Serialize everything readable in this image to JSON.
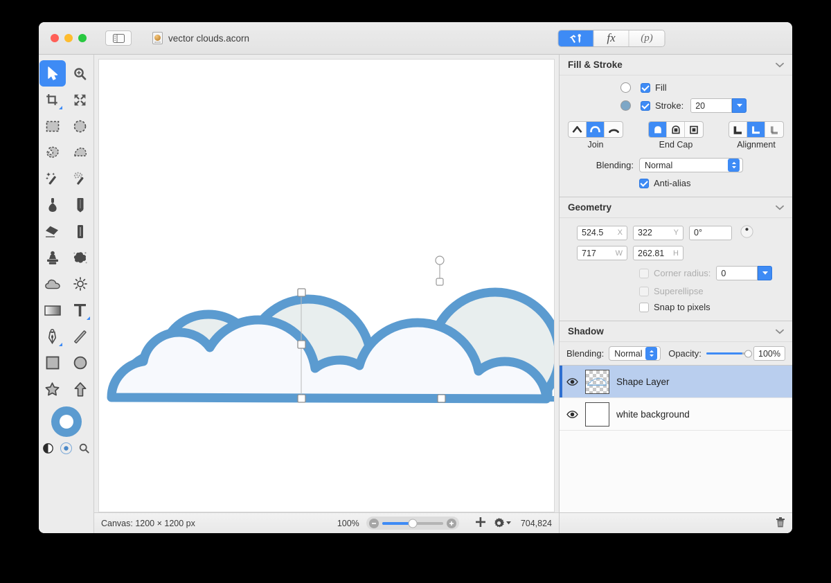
{
  "window": {
    "title": "vector clouds.acorn",
    "doc_icon_label": "acorn",
    "traffic_lights": [
      "close",
      "minimize",
      "zoom"
    ],
    "sidebar_toggle_icon": "sidebar-toggle-icon"
  },
  "tabs": [
    {
      "id": "tools",
      "label": "",
      "icon": "hammer-pen-icon",
      "active": true
    },
    {
      "id": "effects",
      "label": "fx",
      "icon": "fx-icon",
      "active": false
    },
    {
      "id": "presets",
      "label": "(p)",
      "icon": "presets-icon",
      "active": false
    }
  ],
  "toolbar": {
    "tools": [
      {
        "name": "move-tool",
        "icon": "arrow-cursor-icon",
        "active": true
      },
      {
        "name": "zoom-tool",
        "icon": "magnifier-plus-icon",
        "active": false
      },
      {
        "name": "crop-tool",
        "icon": "crop-icon",
        "active": false,
        "corner": true
      },
      {
        "name": "transform-tool",
        "icon": "move-arrows-icon",
        "active": false
      },
      {
        "name": "rect-select-tool",
        "icon": "rect-marquee-icon",
        "active": false
      },
      {
        "name": "ellipse-select-tool",
        "icon": "ellipse-marquee-icon",
        "active": false
      },
      {
        "name": "lasso-tool",
        "icon": "lasso-icon",
        "active": false
      },
      {
        "name": "polygon-lasso-tool",
        "icon": "polygon-lasso-icon",
        "active": false
      },
      {
        "name": "magic-wand-tool",
        "icon": "magic-wand-icon",
        "active": false
      },
      {
        "name": "instant-alpha-tool",
        "icon": "magic-wand-dotted-icon",
        "active": false
      },
      {
        "name": "paint-bucket-tool",
        "icon": "ink-dropper-icon",
        "active": false
      },
      {
        "name": "pencil-tool",
        "icon": "pencil-icon",
        "active": false
      },
      {
        "name": "eraser-tool",
        "icon": "eraser-icon",
        "active": false
      },
      {
        "name": "blur-tool",
        "icon": "blur-stick-icon",
        "active": false
      },
      {
        "name": "clone-stamp-tool",
        "icon": "clone-stamp-icon",
        "active": false
      },
      {
        "name": "smudge-tool",
        "icon": "smudge-splat-icon",
        "active": false
      },
      {
        "name": "cloud-tool",
        "icon": "cloud-icon",
        "active": false
      },
      {
        "name": "dodge-tool",
        "icon": "sun-icon",
        "active": false
      },
      {
        "name": "gradient-tool",
        "icon": "gradient-icon",
        "active": false
      },
      {
        "name": "text-tool",
        "icon": "text-t-icon",
        "active": false,
        "corner": true
      },
      {
        "name": "bezier-pen-tool",
        "icon": "fountain-pen-icon",
        "active": false,
        "corner": true
      },
      {
        "name": "line-tool",
        "icon": "line-icon",
        "active": false
      },
      {
        "name": "rectangle-tool",
        "icon": "square-icon",
        "active": false
      },
      {
        "name": "oval-tool",
        "icon": "circle-icon",
        "active": false
      },
      {
        "name": "star-tool",
        "icon": "star-icon",
        "active": false
      },
      {
        "name": "arrow-tool",
        "icon": "up-arrow-icon",
        "active": false
      }
    ],
    "color_tool": {
      "name": "color-picker-tool",
      "icon": "color-ring-icon",
      "color": "#5b9bd0"
    },
    "mini_tools": [
      {
        "name": "invert-colors-button",
        "icon": "yin-yang-icon",
        "selected": false
      },
      {
        "name": "default-colors-button",
        "icon": "target-dot-icon",
        "selected": true
      },
      {
        "name": "loupe-button",
        "icon": "magnifier-icon",
        "selected": false
      }
    ]
  },
  "inspector": {
    "fill_stroke": {
      "title": "Fill & Stroke",
      "collapse_icon": "chevron-down-icon",
      "fill": {
        "label": "Fill",
        "checked": true,
        "color": "#ffffff"
      },
      "stroke": {
        "label": "Stroke:",
        "checked": true,
        "color": "#7ea7c6",
        "width": "20",
        "stepper_icon": "chevron-down-icon"
      },
      "join": {
        "label": "Join",
        "options": [
          "miter-join",
          "round-join",
          "bevel-join"
        ],
        "selected_index": 1
      },
      "end_cap": {
        "label": "End Cap",
        "options": [
          "round-cap",
          "butt-cap",
          "square-cap"
        ],
        "selected_index": 0
      },
      "alignment": {
        "label": "Alignment",
        "options": [
          "align-inside",
          "align-center",
          "align-outside"
        ],
        "selected_index": 1
      },
      "blending": {
        "label": "Blending:",
        "value": "Normal"
      },
      "anti_alias": {
        "label": "Anti-alias",
        "checked": true
      }
    },
    "geometry": {
      "title": "Geometry",
      "collapse_icon": "chevron-down-icon",
      "x": {
        "value": "524.5",
        "unit": "X"
      },
      "y": {
        "value": "322",
        "unit": "Y"
      },
      "rotation": {
        "value": "0°"
      },
      "rotation_dial_icon": "rotation-dial-icon",
      "w": {
        "value": "717",
        "unit": "W"
      },
      "h": {
        "value": "262.81",
        "unit": "H"
      },
      "corner_radius": {
        "label": "Corner radius:",
        "checked": false,
        "disabled": true,
        "value": "0"
      },
      "superellipse": {
        "label": "Superellipse",
        "checked": false,
        "disabled": true
      },
      "snap_to_pixels": {
        "label": "Snap to pixels",
        "checked": false,
        "disabled": false
      }
    },
    "shadow": {
      "title": "Shadow",
      "collapse_icon": "chevron-down-icon",
      "blending": {
        "label": "Blending:",
        "value": "Normal"
      },
      "opacity": {
        "label": "Opacity:",
        "value": "100%",
        "percent": 100
      }
    },
    "layers": [
      {
        "name": "Shape Layer",
        "visible": true,
        "selected": true,
        "thumbnail": "transparent-cloud-thumb"
      },
      {
        "name": "white background",
        "visible": true,
        "selected": false,
        "thumbnail": "white-thumb"
      }
    ],
    "layer_footer": {
      "add_icon": "plus-icon",
      "settings_icon": "gear-icon",
      "delete_icon": "trash-icon"
    }
  },
  "statusbar": {
    "canvas_label": "Canvas: 1200 × 1200 px",
    "zoom_level": "100%",
    "zoom_out_icon": "minus-icon",
    "zoom_in_icon": "plus-icon",
    "add_layer_icon": "plus-icon",
    "settings_icon": "gear-icon",
    "coordinates": "704,824"
  },
  "canvas": {
    "artwork_name": "vector-clouds-artwork",
    "stroke_color": "#5b9bd0",
    "fill_color": "#f7f9fd",
    "back_cloud_fill": "#e8eeee",
    "selection": {
      "handle_icon": "selection-handle",
      "rotation_handle_icon": "rotation-handle"
    }
  }
}
